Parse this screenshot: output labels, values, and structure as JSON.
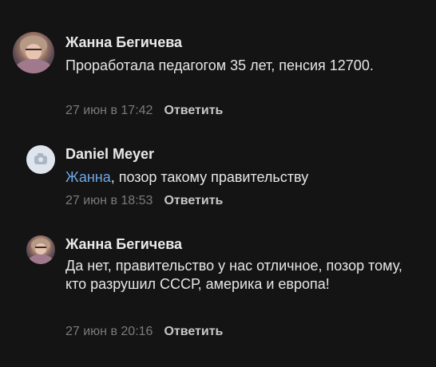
{
  "comments": [
    {
      "author": "Жанна Бегичева",
      "text": "Проработала педагогом 35 лет, пенсия 12700.",
      "date": "27 июн в 17:42",
      "reply": "Ответить"
    },
    {
      "author": "Daniel Meyer",
      "mention": "Жанна",
      "text": ", позор такому правительству",
      "date": "27 июн в 18:53",
      "reply": "Ответить"
    },
    {
      "author": "Жанна Бегичева",
      "text": "Да нет, правительство у нас отличное, позор тому, кто разрушил СССР, америка и европа!",
      "date": "27 июн в 20:16",
      "reply": "Ответить"
    }
  ],
  "colors": {
    "background": "#141414",
    "mention": "#71a8e8",
    "date": "#7b7b7b"
  },
  "icons": {
    "default_avatar": "camera-icon"
  }
}
